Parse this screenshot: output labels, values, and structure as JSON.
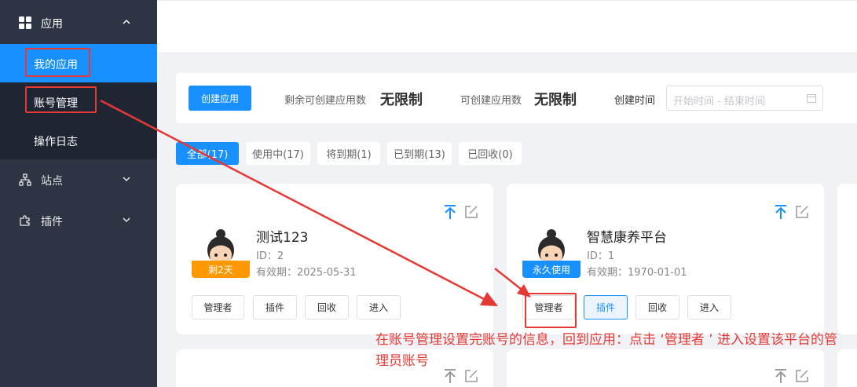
{
  "sidebar": {
    "app_group": "应用",
    "sub_items": [
      "我的应用",
      "账号管理",
      "操作日志"
    ],
    "site_group": "站点",
    "plugin_group": "插件"
  },
  "toolbar": {
    "create_button": "创建应用",
    "remaining_label": "剩余可创建应用数",
    "remaining_value": "无限制",
    "can_create_label": "可创建应用数",
    "can_create_value": "无限制",
    "time_label": "创建时间",
    "date_placeholder": "开始时间 - 结束时间"
  },
  "tabs": [
    "全部(17)",
    "使用中(17)",
    "将到期(1)",
    "已到期(13)",
    "已回收(0)"
  ],
  "cards": [
    {
      "title": "测试123",
      "id": "ID：2",
      "expiry": "有效期：2025-05-31",
      "badge": "剩2天",
      "buttons": [
        "管理者",
        "插件",
        "回收",
        "进入"
      ]
    },
    {
      "title": "智慧康养平台",
      "id": "ID：1",
      "expiry": "有效期：1970-01-01",
      "badge": "永久使用",
      "buttons": [
        "管理者",
        "插件",
        "回收",
        "进入"
      ]
    }
  ],
  "annotation": {
    "text": "在账号管理设置完账号的信息，回到应用：点击 ‘管理者 ’ 进入设置该平台的管理员账号",
    "color": "#e53935"
  },
  "colors": {
    "primary": "#1890ff",
    "sidebar": "#2d3444",
    "badge_orange": "#ff9800"
  }
}
